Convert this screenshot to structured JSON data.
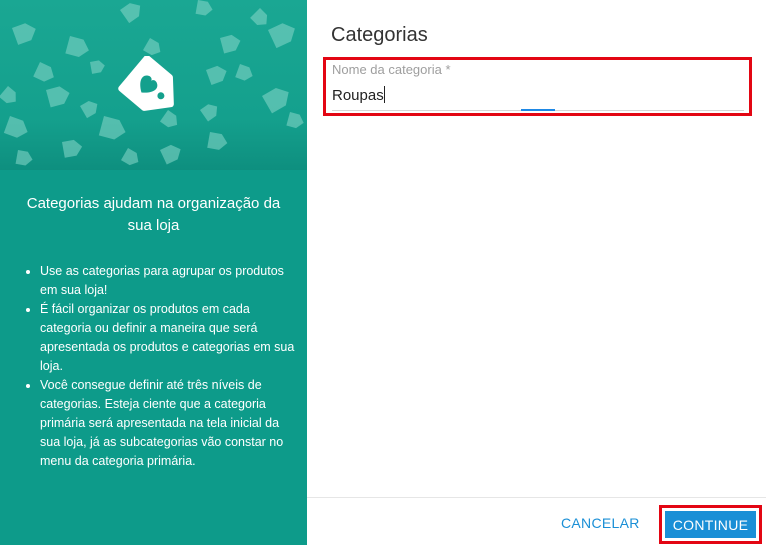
{
  "sidebar": {
    "headline": "Categorias ajudam na organização da sua loja",
    "bullets": [
      "Use as categorias para agrupar os produtos em sua loja!",
      "É fácil organizar os produtos em cada categoria ou definir a maneira que será apresentada os produtos e categorias em sua loja.",
      "Você consegue definir até três níveis de categorias. Esteja ciente que a categoria primária será apresentada na tela inicial da sua loja, já as subcategorias vão constar no menu da categoria primária."
    ],
    "banner_icon": "price-tag-heart-icon"
  },
  "main": {
    "title": "Categorias",
    "field": {
      "label": "Nome da categoria *",
      "value": "Roupas"
    }
  },
  "footer": {
    "cancel_label": "CANCELAR",
    "continue_label": "CONTINUE"
  },
  "colors": {
    "accent": "#1a8fd6",
    "sidebar": "#0d9b8a",
    "highlight": "#e30613"
  }
}
